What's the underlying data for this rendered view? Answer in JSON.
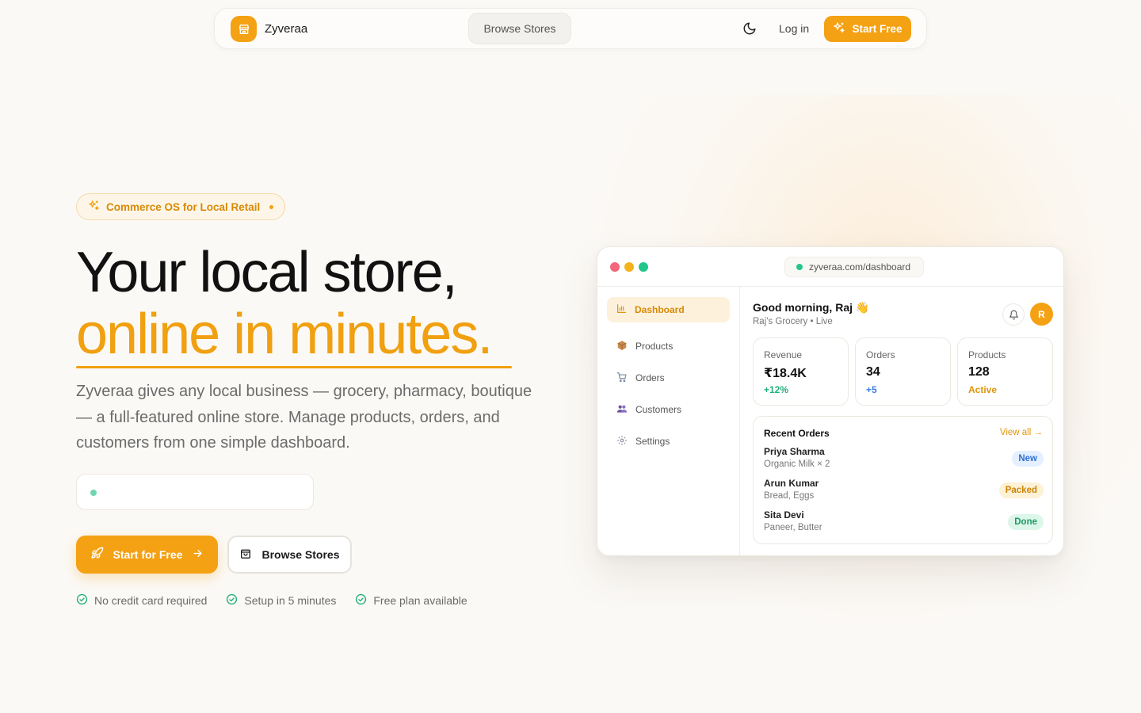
{
  "nav": {
    "brand": "Zyveraa",
    "browse_label": "Browse Stores",
    "login_label": "Log in",
    "start_label": "Start Free"
  },
  "hero": {
    "badge": "Commerce OS for Local Retail",
    "title_line1": "Your local store,",
    "title_line2": "online in minutes.",
    "lead": "Zyveraa gives any local business — grocery, pharmacy, boutique — a full-featured online store. Manage products, orders, and customers from one simple dashboard.",
    "cta_primary": "Start for Free",
    "cta_secondary": "Browse Stores",
    "checks": [
      "No credit card required",
      "Setup in 5 minutes",
      "Free plan available"
    ]
  },
  "mock": {
    "url": "zyveraa.com/dashboard",
    "sidebar": [
      {
        "label": "Dashboard",
        "icon": "bar-chart-icon",
        "active": true
      },
      {
        "label": "Products",
        "icon": "box-icon"
      },
      {
        "label": "Orders",
        "icon": "cart-icon"
      },
      {
        "label": "Customers",
        "icon": "users-icon"
      },
      {
        "label": "Settings",
        "icon": "gear-icon"
      }
    ],
    "greeting": "Good morning, Raj 👋",
    "subtitle": "Raj's Grocery • Live",
    "avatar_initial": "R",
    "stats": [
      {
        "label": "Revenue",
        "value": "₹18.4K",
        "delta": "+12%",
        "color": "#22b07a"
      },
      {
        "label": "Orders",
        "value": "34",
        "delta": "+5",
        "color": "#3b7de0"
      },
      {
        "label": "Products",
        "value": "128",
        "delta": "Active",
        "color": "#e0950d"
      }
    ],
    "orders": {
      "title": "Recent Orders",
      "view_all": "View all →",
      "rows": [
        {
          "name": "Priya Sharma",
          "items": "Organic Milk × 2",
          "status": "New",
          "bg": "#e4efff",
          "fg": "#2f6fd6"
        },
        {
          "name": "Arun Kumar",
          "items": "Bread, Eggs",
          "status": "Packed",
          "bg": "#fdf1d6",
          "fg": "#c98308"
        },
        {
          "name": "Sita Devi",
          "items": "Paneer, Butter",
          "status": "Done",
          "bg": "#dcf6ea",
          "fg": "#1c9a64"
        }
      ]
    }
  },
  "colors": {
    "accent": "#f4a114",
    "title_accent": "#f0a010",
    "background": "#fbf9f6"
  }
}
